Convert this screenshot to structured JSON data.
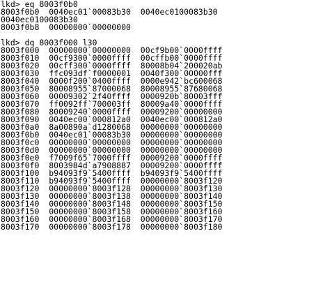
{
  "block1": {
    "command": "lkd> eq 8003f0b0",
    "lines": [
      "8003f0b0  0040ec01`00083b30  0040ec0100083b30",
      "0040ec0100083b30",
      "8003f0b8  00000000`00000000"
    ]
  },
  "block2": {
    "command": "lkd> dq 8003f000 l30",
    "rows": [
      "8003f000  00000000`00000000  00cf9b00`0000ffff",
      "8003f010  00cf9300`0000ffff  00cffb00`0000ffff",
      "8003f020  00cff300`0000ffff  80008b04`200020ab",
      "8003f030  ffc093df`f0000001  0040f300`00000fff",
      "8003f040  0000f200`0400ffff  0000e942`bc600068",
      "8003f050  80008955`87000068  80008955`87680068",
      "8003f060  00009302`2f40ffff  0000920b`80003fff",
      "8003f070  ff0092ff`700003ff  80009a40`0000ffff",
      "8003f080  80009240`0000ffff  00009200`00000000",
      "8003f090  0040ec00`000812a0  0040ec00`000812a0",
      "8003f0a0  8a00890a`d1280068  00000000`00000000",
      "8003f0b0  0040ec01`00083b30  00000000`00000000",
      "8003f0c0  00000000`00000000  00000000`00000000",
      "8003f0d0  00000000`00000000  00000000`00000000",
      "8003f0e0  f7009f65`7000ffff  00009200`0000ffff",
      "8003f0f0  8003984d`a7908887  00009200`0000ffff",
      "8003f100  b94093f9`5400ffff  b94093f9`5400ffff",
      "8003f110  b94093f9`5400ffff  00000000`8003f120",
      "8003f120  00000000`8003f128  00000000`8003f130",
      "8003f130  00000000`8003f138  00000000`8003f140",
      "8003f140  00000000`8003f148  00000000`8003f150",
      "8003f150  00000000`8003f158  00000000`8003f160",
      "8003f160  00000000`8003f168  00000000`8003f170",
      "8003f170  00000000`8003f178  00000000`8003f180"
    ]
  }
}
